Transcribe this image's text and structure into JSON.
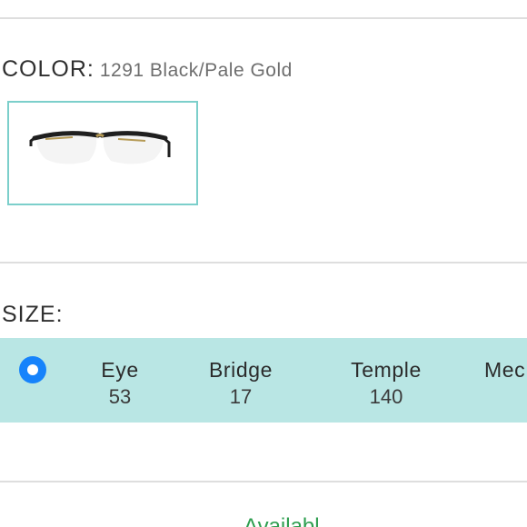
{
  "color_section": {
    "label": "COLOR:",
    "value": "1291 Black/Pale Gold",
    "swatch": {
      "name": "1291 Black/Pale Gold",
      "selected": true,
      "border_color": "#7ccfcb",
      "frame_color": "#1f1f1f",
      "temple_color": "#b59a55"
    }
  },
  "size_section": {
    "label": "SIZE:",
    "selected": true,
    "row_color": "#b9e6e4",
    "radio_color": "#1683fb",
    "columns": [
      {
        "header": "Eye",
        "value": "53"
      },
      {
        "header": "Bridge",
        "value": "17"
      },
      {
        "header": "Temple",
        "value": "140"
      },
      {
        "header": "Mec",
        "value": ""
      }
    ]
  },
  "availability": {
    "text": "Availabl",
    "color": "#2e9e4f"
  }
}
